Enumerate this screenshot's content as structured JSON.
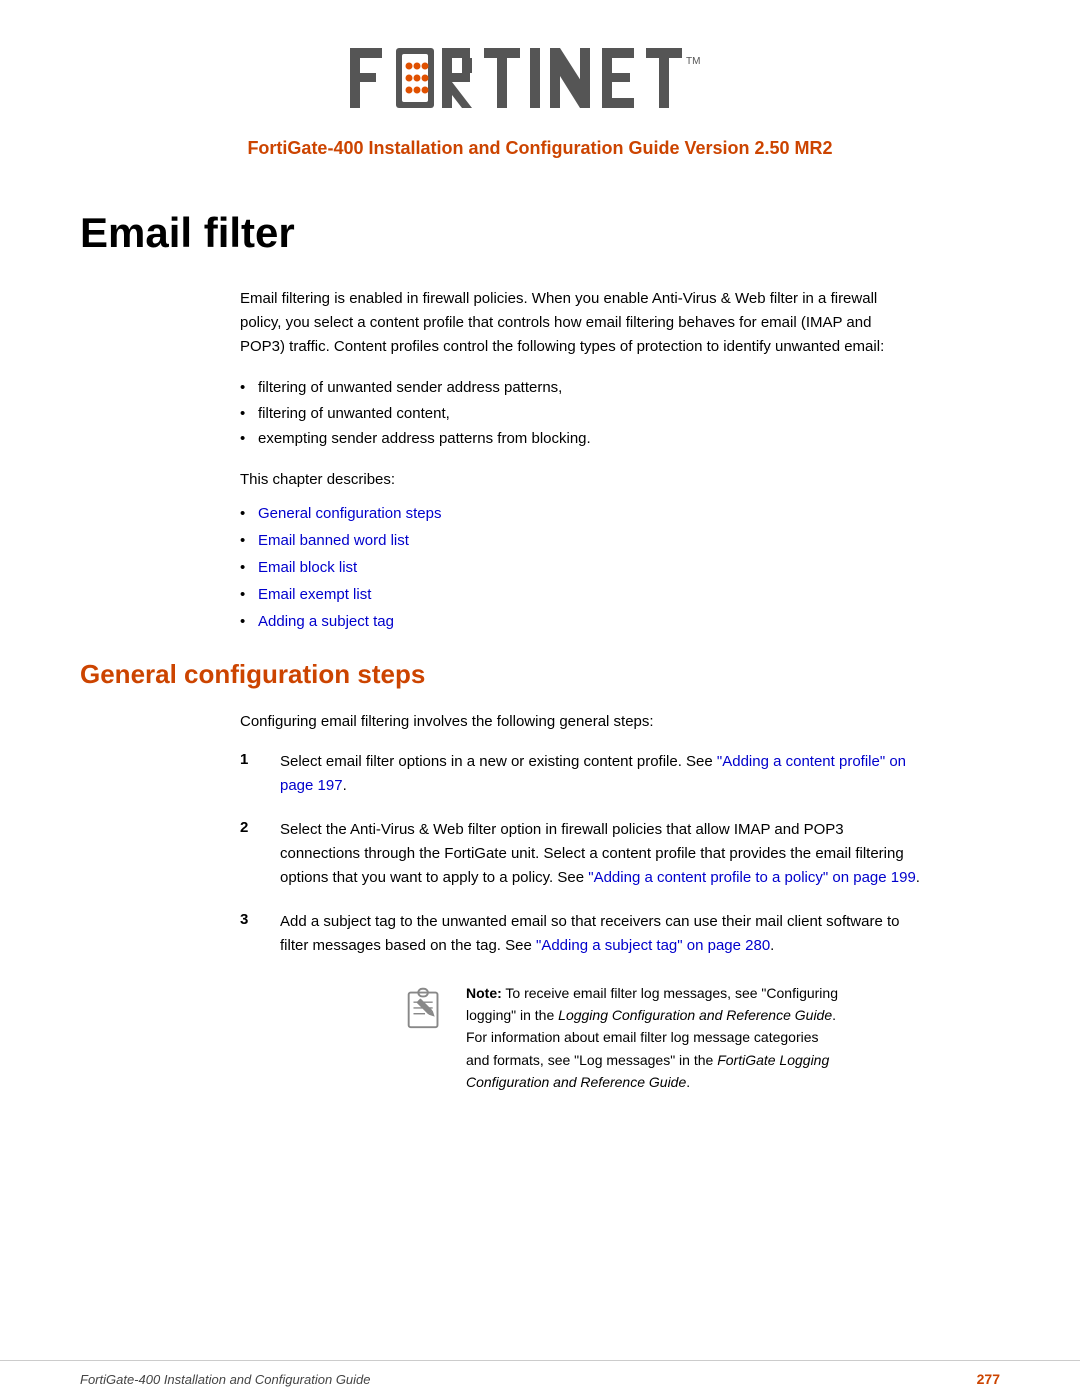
{
  "header": {
    "logo_alt": "FORTINET",
    "subtitle": "FortiGate-400 Installation and Configuration Guide Version 2.50 MR2"
  },
  "chapter": {
    "title": "Email filter",
    "intro_paragraph": "Email filtering is enabled in firewall policies. When you enable Anti-Virus & Web filter in a firewall policy, you select a content profile that controls how email filtering behaves for email (IMAP and POP3) traffic. Content profiles control the following types of protection to identify unwanted email:",
    "bullet_items": [
      "filtering of unwanted sender address patterns,",
      "filtering of unwanted content,",
      "exempting sender address patterns from blocking."
    ],
    "chapter_describes": "This chapter describes:",
    "link_items": [
      "General configuration steps",
      "Email banned word list",
      "Email block list",
      "Email exempt list",
      "Adding a subject tag"
    ]
  },
  "section": {
    "heading": "General configuration steps",
    "intro": "Configuring email filtering involves the following general steps:",
    "steps": [
      {
        "number": "1",
        "text": "Select email filter options in a new or existing content profile. See “Adding a content profile” on page 197."
      },
      {
        "number": "2",
        "text": "Select the Anti-Virus & Web filter option in firewall policies that allow IMAP and POP3 connections through the FortiGate unit. Select a content profile that provides the email filtering options that you want to apply to a policy. See “Adding a content profile to a policy” on page 199."
      },
      {
        "number": "3",
        "text": "Add a subject tag to the unwanted email so that receivers can use their mail client software to filter messages based on the tag. See “Adding a subject tag” on page 280."
      }
    ],
    "note": {
      "label": "Note:",
      "text_parts": [
        "To receive email filter log messages, see “Configuring logging” in the ",
        "Logging Configuration and Reference Guide",
        ". For information about email filter log message categories and formats, see “Log messages” in the ",
        "FortiGate Logging Configuration and Reference Guide",
        "."
      ]
    }
  },
  "footer": {
    "left": "FortiGate-400 Installation and Configuration Guide",
    "right": "277"
  }
}
